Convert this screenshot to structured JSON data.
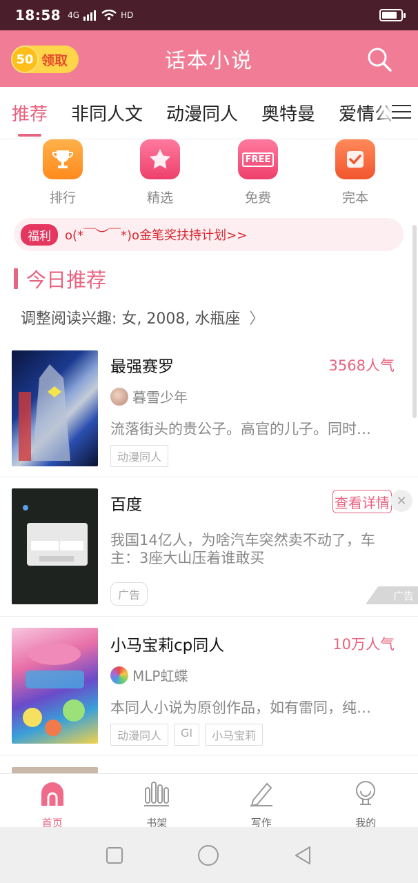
{
  "status_bar": {
    "time": "18:58",
    "network": "4G",
    "hd": "HD"
  },
  "app_bar": {
    "title": "话本小说",
    "coin_value": "50",
    "coin_label": "领取"
  },
  "tabs": [
    {
      "label": "推荐",
      "active": true
    },
    {
      "label": "非同人文"
    },
    {
      "label": "动漫同人"
    },
    {
      "label": "奥特曼"
    },
    {
      "label": "爱情公"
    }
  ],
  "quick_links": [
    {
      "label": "排行",
      "icon": "trophy-icon",
      "color": "#ff9a2e"
    },
    {
      "label": "精选",
      "icon": "star-icon",
      "color": "#f2557e"
    },
    {
      "label": "免费",
      "icon": "free-icon",
      "color": "#f2557e",
      "icon_text": "FREE"
    },
    {
      "label": "完本",
      "icon": "check-icon",
      "color": "#ff6b3d"
    }
  ],
  "welfare": {
    "badge": "福利",
    "text": "o(*￣︶￣*)o金笔奖扶持计划>>"
  },
  "section": {
    "title": "今日推荐",
    "preference": "调整阅读兴趣: 女, 2008, 水瓶座"
  },
  "books": [
    {
      "title": "最强赛罗",
      "popularity": "3568人气",
      "author": "暮雪少年",
      "description": "流落街头的贵公子。高官的儿子。同时…",
      "tags": [
        "动漫同人"
      ]
    },
    {
      "title": "小马宝莉cp同人",
      "popularity": "10万人气",
      "author": "MLP虹蝶",
      "description": "本同人小说为原创作品，如有雷同，纯…",
      "tags": [
        "动漫同人",
        "GI",
        "小马宝莉"
      ]
    }
  ],
  "ad": {
    "title": "百度",
    "button": "查看详情",
    "description": "我国14亿人，为啥汽车突然卖不动了，车主：3座大山压着谁敢买",
    "tag": "广告",
    "corner": "广告"
  },
  "bottom_nav": [
    {
      "label": "首页",
      "active": true
    },
    {
      "label": "书架"
    },
    {
      "label": "写作"
    },
    {
      "label": "我的"
    }
  ],
  "colors": {
    "accent": "#e8637f",
    "app_bar": "#f17c96",
    "status_bar": "#4a1f2b"
  }
}
